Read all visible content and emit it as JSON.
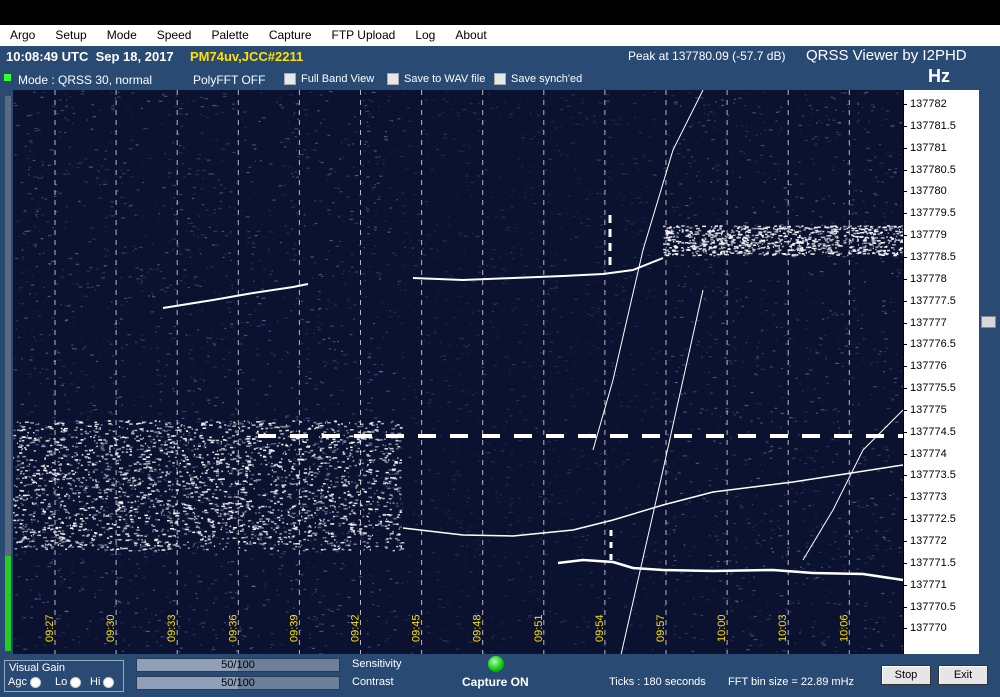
{
  "menu": [
    "Argo",
    "Setup",
    "Mode",
    "Speed",
    "Palette",
    "Capture",
    "FTP Upload",
    "Log",
    "About"
  ],
  "status": {
    "utc_date": "10:08:49 UTC  Sep 18, 2017",
    "callsign": "PM74uv,JCC#2211",
    "peak": "Peak at   137780.09 (-57.7 dB)",
    "app_title": "QRSS Viewer by I2PHD",
    "hz_label": "Hz"
  },
  "options": {
    "mode": "Mode : QRSS 30, normal",
    "polyfft": "PolyFFT OFF",
    "full_band": "Full Band View",
    "save_wav": "Save to WAV file",
    "save_sync": "Save synch'ed"
  },
  "freq_ticks": [
    "137782",
    "137781.5",
    "137781",
    "137780.5",
    "137780",
    "137779.5",
    "137779",
    "137778.5",
    "137778",
    "137777.5",
    "137777",
    "137776.5",
    "137776",
    "137775.5",
    "137775",
    "137774.5",
    "137774",
    "137773.5",
    "137773",
    "137772.5",
    "137772",
    "137771.5",
    "137771",
    "137770.5",
    "137770"
  ],
  "time_ticks": [
    "09:27",
    "09:30",
    "09:33",
    "09:36",
    "09:39",
    "09:42",
    "09:45",
    "09:48",
    "09:51",
    "09:54",
    "09:57",
    "10:00",
    "10:03",
    "10:06"
  ],
  "visual_gain": {
    "title": "Visual Gain",
    "agc": "Agc",
    "lo": "Lo",
    "hi": "Hi"
  },
  "sensitivity": {
    "label": "Sensitivity",
    "value_text": "50/100",
    "value": 50
  },
  "contrast": {
    "label": "Contrast",
    "value_text": "50/100",
    "value": 50
  },
  "capture": "Capture ON",
  "ticks": "Ticks   : 180 seconds",
  "fft_bin": "FFT bin size = 22.89 mHz",
  "buttons": {
    "stop": "Stop",
    "exit": "Exit"
  },
  "colors": {
    "panel": "#294a73",
    "waterfall_bg": "#0a1230",
    "trace": "#ffffff",
    "time_label": "#ffe000"
  }
}
